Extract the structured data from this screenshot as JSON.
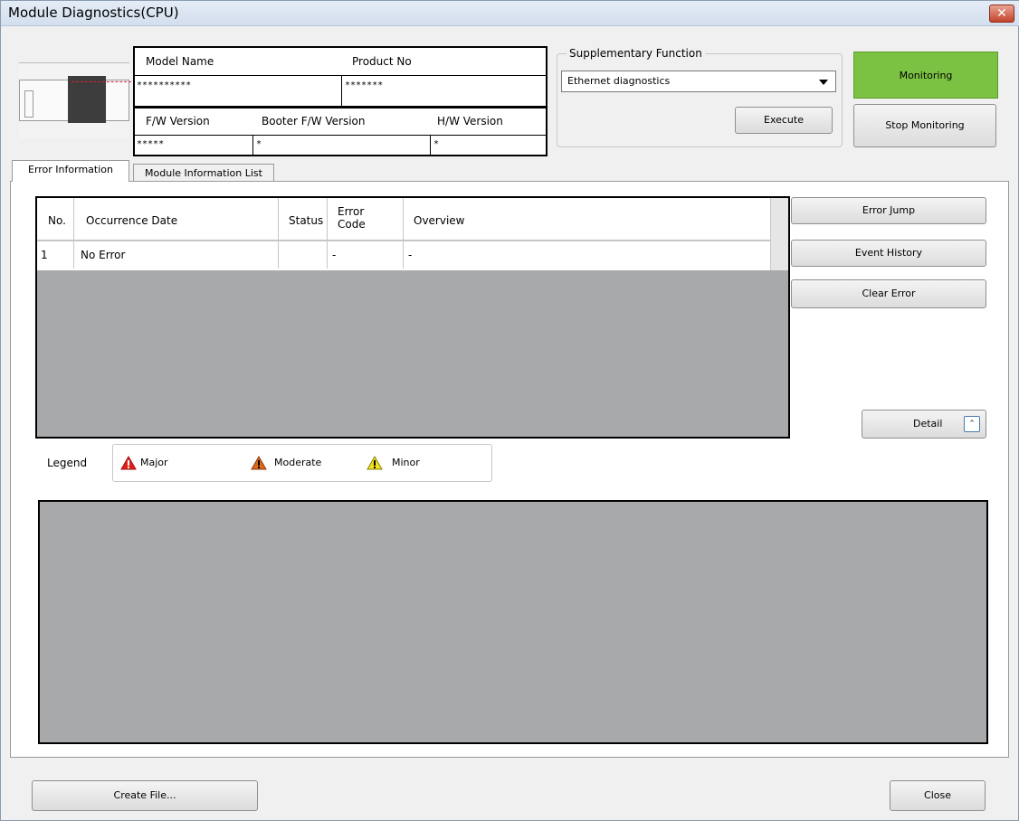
{
  "window": {
    "title": "Module Diagnostics(CPU)",
    "close_glyph": "✕"
  },
  "module": {
    "model_name_label": "Model Name",
    "model_name_value": "**********",
    "product_no_label": "Product No",
    "product_no_value": "*******",
    "fw_version_label": "F/W Version",
    "fw_version_value": "*****",
    "booter_fw_label": "Booter F/W Version",
    "booter_fw_value": "*",
    "hw_version_label": "H/W Version",
    "hw_version_value": "*"
  },
  "supplementary": {
    "legend": "Supplementary Function",
    "selected": "Ethernet diagnostics",
    "execute_label": "Execute"
  },
  "monitoring": {
    "status": "Monitoring",
    "status_color": "#7cc242",
    "stop_label": "Stop Monitoring"
  },
  "tabs": [
    {
      "label": "Error Information"
    },
    {
      "label": "Module Information List"
    }
  ],
  "error_table": {
    "headers": {
      "no": "No.",
      "date": "Occurrence Date",
      "status": "Status",
      "code": "Error Code",
      "overview": "Overview"
    },
    "rows": [
      {
        "no": "1",
        "date": "No Error",
        "status": "",
        "code": "-",
        "overview": "-"
      }
    ]
  },
  "side_buttons": {
    "error_jump": "Error Jump",
    "event_history": "Event History",
    "clear_error": "Clear Error",
    "detail": "Detail"
  },
  "legend": {
    "label": "Legend",
    "major": "Major",
    "moderate": "Moderate",
    "minor": "Minor"
  },
  "footer": {
    "create_file": "Create File...",
    "close": "Close"
  }
}
